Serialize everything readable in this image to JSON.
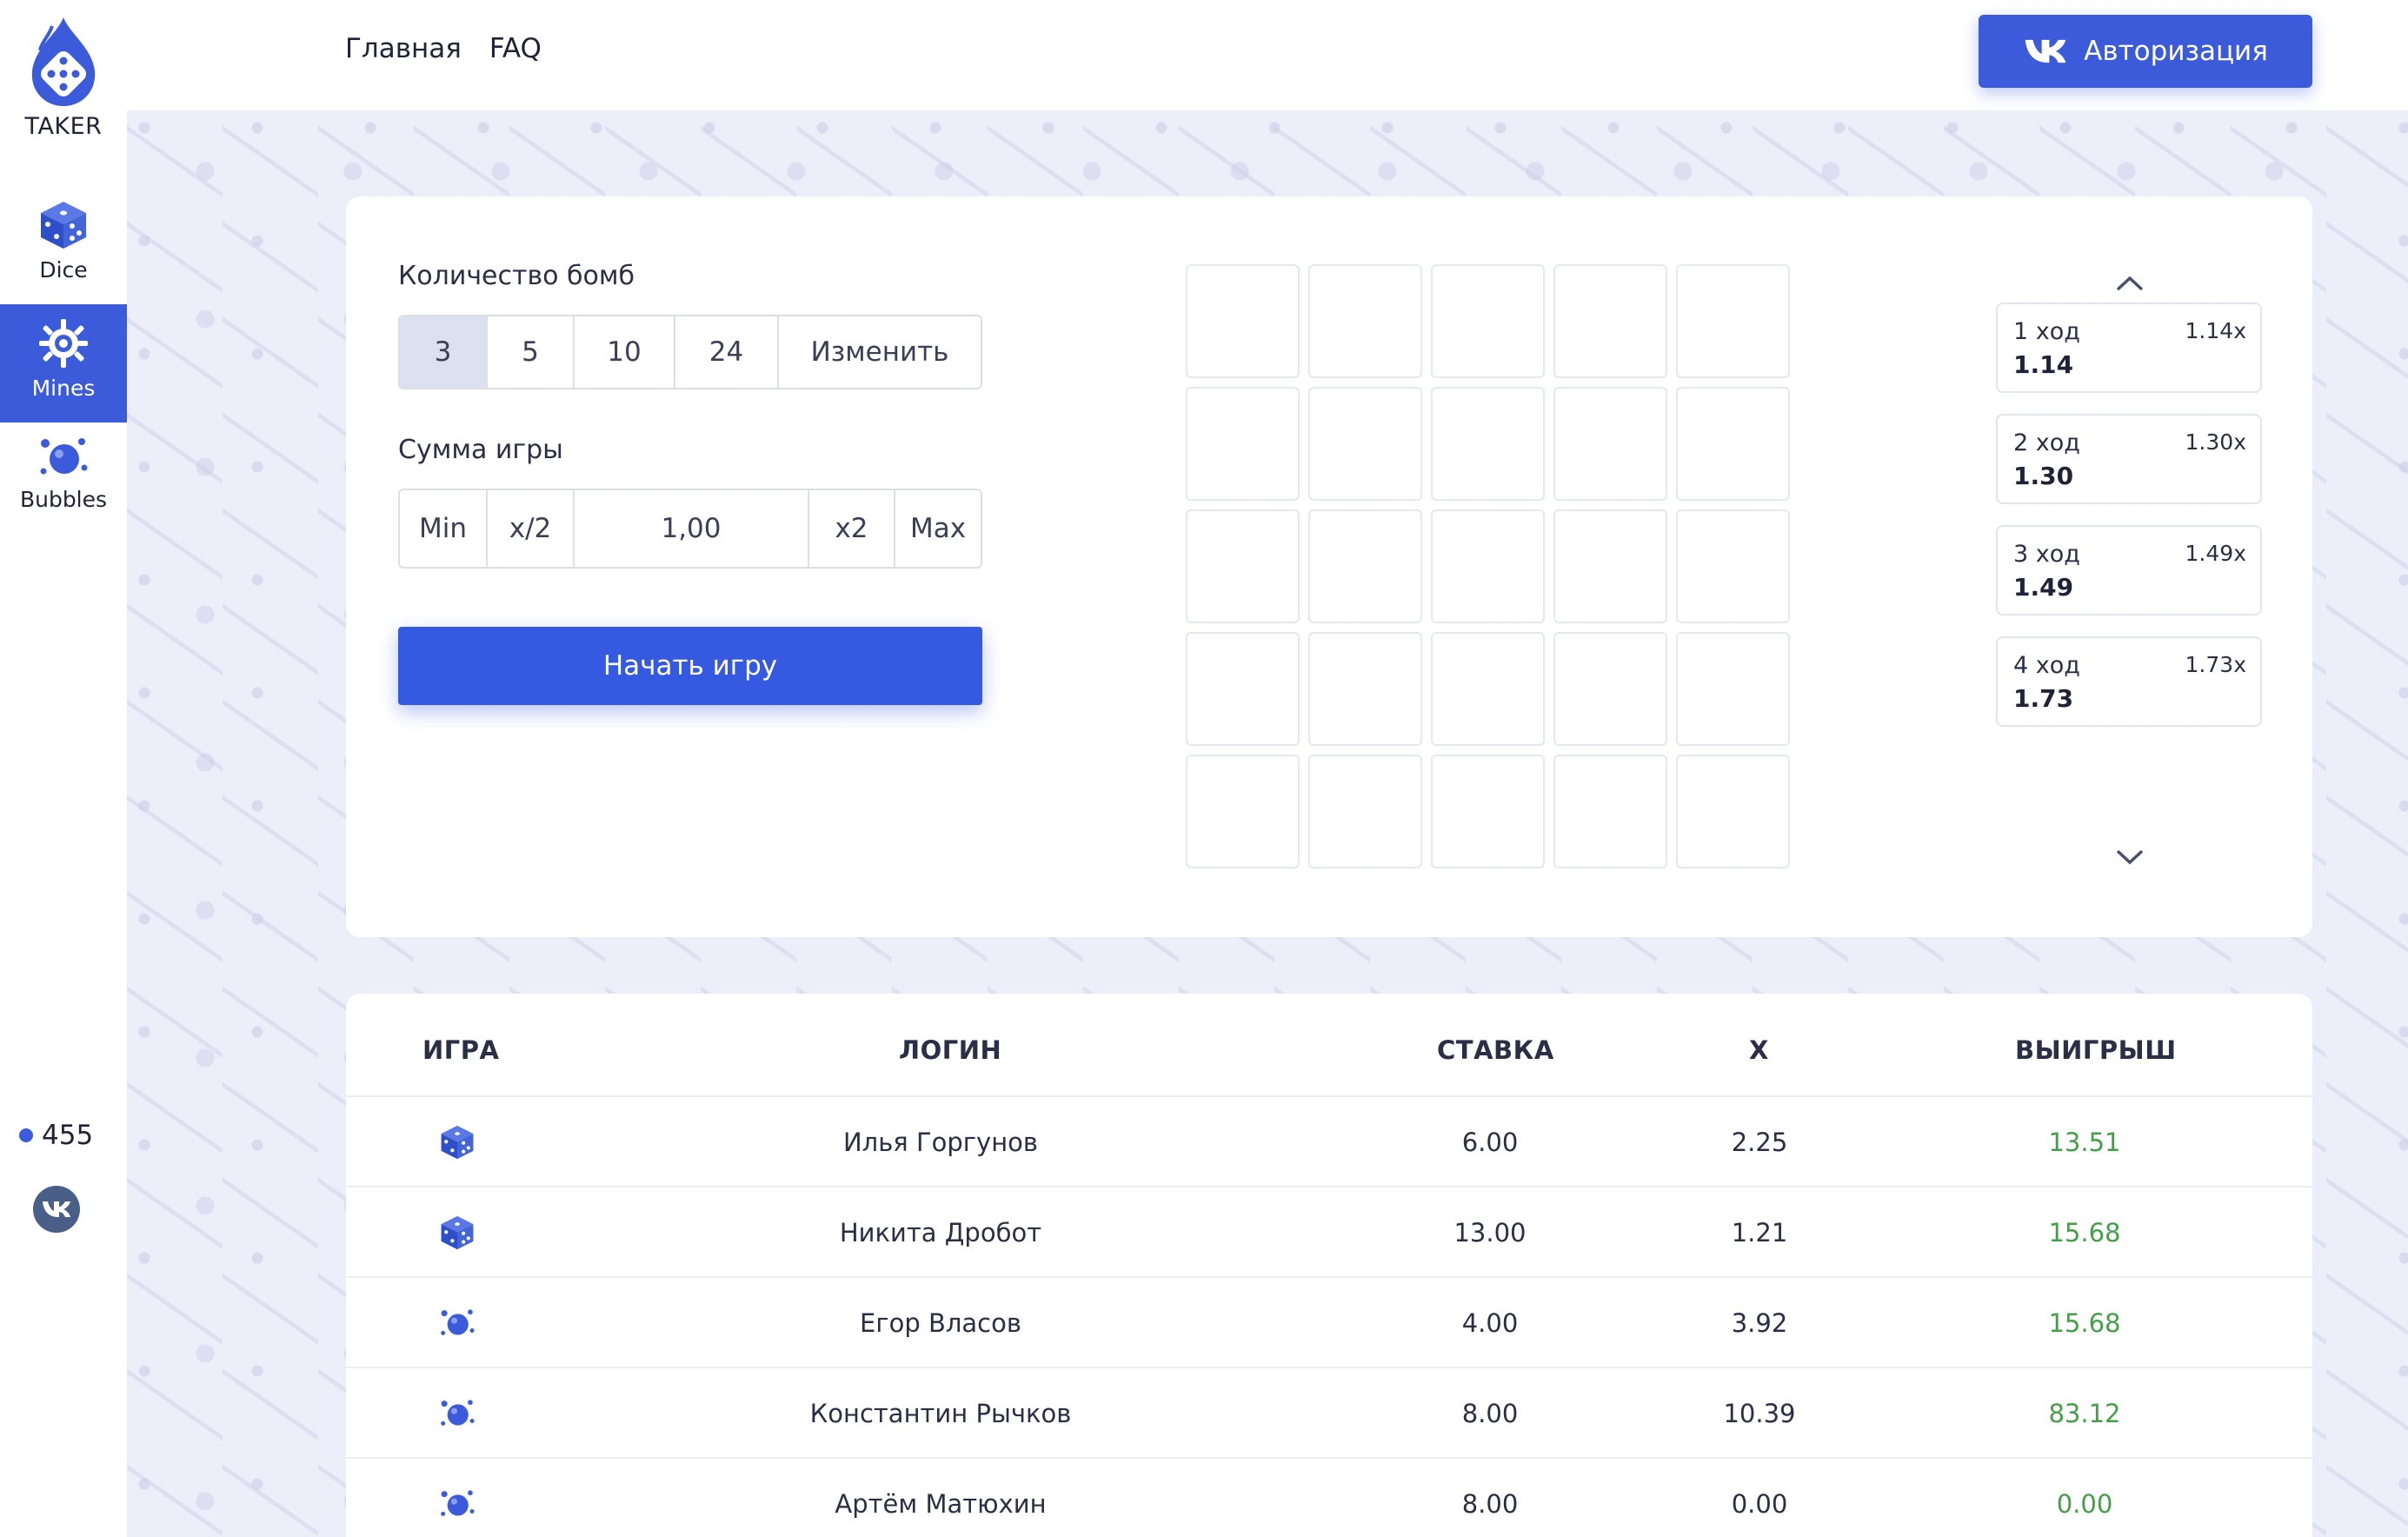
{
  "app": {
    "logo_text": "TAKER",
    "accent": "#3b5bdb",
    "win_color": "#44a047"
  },
  "sidebar": {
    "items": [
      {
        "label": "Dice",
        "icon": "dice-icon"
      },
      {
        "label": "Mines",
        "icon": "mine-icon",
        "active": true
      },
      {
        "label": "Bubbles",
        "icon": "bubbles-icon"
      }
    ],
    "online_count": "455"
  },
  "header": {
    "nav": [
      "Главная",
      "FAQ"
    ],
    "auth_label": "Авторизация"
  },
  "game": {
    "bombs_label": "Количество бомб",
    "bomb_options": [
      "3",
      "5",
      "10",
      "24",
      "Изменить"
    ],
    "bomb_selected": "3",
    "amount_label": "Сумма игры",
    "amount_controls": [
      "Min",
      "x/2",
      "1,00",
      "x2",
      "Max"
    ],
    "amount_value": "1,00",
    "start_label": "Начать игру",
    "grid_size": 5,
    "steps": [
      {
        "label": "1 ход",
        "value": "1.14",
        "mult": "1.14x"
      },
      {
        "label": "2 ход",
        "value": "1.30",
        "mult": "1.30x"
      },
      {
        "label": "3 ход",
        "value": "1.49",
        "mult": "1.49x"
      },
      {
        "label": "4 ход",
        "value": "1.73",
        "mult": "1.73x"
      }
    ]
  },
  "history": {
    "columns": [
      "ИГРА",
      "ЛОГИН",
      "СТАВКА",
      "X",
      "ВЫИГРЫШ"
    ],
    "rows": [
      {
        "game_icon": "dice-icon",
        "login": "Илья Горгунов",
        "bet": "6.00",
        "x": "2.25",
        "win": "13.51"
      },
      {
        "game_icon": "dice-icon",
        "login": "Никита Дробот",
        "bet": "13.00",
        "x": "1.21",
        "win": "15.68"
      },
      {
        "game_icon": "bubbles-icon",
        "login": "Егор Власов",
        "bet": "4.00",
        "x": "3.92",
        "win": "15.68"
      },
      {
        "game_icon": "bubbles-icon",
        "login": "Константин Рычков",
        "bet": "8.00",
        "x": "10.39",
        "win": "83.12"
      },
      {
        "game_icon": "bubbles-icon",
        "login": "Артём Матюхин",
        "bet": "8.00",
        "x": "0.00",
        "win": "0.00"
      }
    ]
  }
}
